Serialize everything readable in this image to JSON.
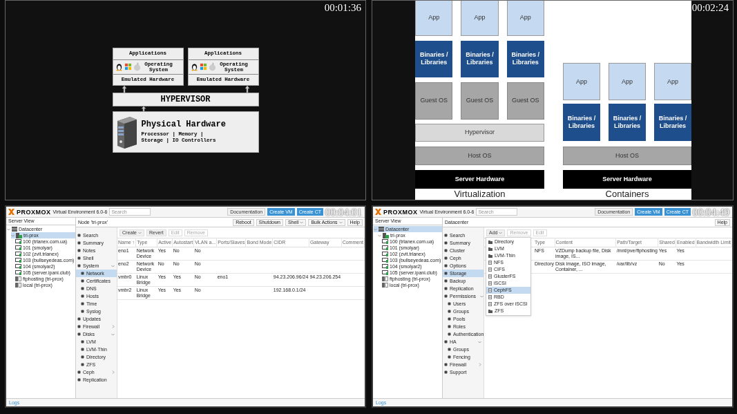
{
  "hypervisor_slide": {
    "timestamp": "00:01:36",
    "vms": [
      {
        "applications": "Applications",
        "os": "Operating System",
        "hardware": "Emulated Hardware"
      },
      {
        "applications": "Applications",
        "os": "Operating System",
        "hardware": "Emulated Hardware"
      }
    ],
    "hypervisor": "HYPERVISOR",
    "physical": {
      "title": "Physical Hardware",
      "specs": [
        "Processor | Memory |",
        "Storage | IO Controllers"
      ]
    }
  },
  "comparison_slide": {
    "timestamp": "00:02:24",
    "virtualization": {
      "apps": [
        "App",
        "App",
        "App"
      ],
      "binaries": [
        "Binaries / Libraries",
        "Binaries / Libraries",
        "Binaries / Libraries"
      ],
      "guests": [
        "Guest OS",
        "Guest OS",
        "Guest OS"
      ],
      "hypervisor": "Hypervisor",
      "host": "Host OS",
      "hardware": "Server Hardware",
      "caption": "Virtualization"
    },
    "containers": {
      "apps": [
        "App",
        "App",
        "App"
      ],
      "binaries": [
        "Binaries / Libraries",
        "Binaries / Libraries",
        "Binaries / Libraries"
      ],
      "host": "Host OS",
      "hardware": "Server Hardware",
      "caption": "Containers"
    }
  },
  "proxmox_panels": [
    {
      "timestamp": "00:04:01",
      "logo": "PROXMOX",
      "version": "Virtual Environment 6.0-6",
      "search_placeholder": "Search",
      "header_buttons": [
        {
          "label": "Documentation",
          "kind": "plain"
        },
        {
          "label": "Create VM",
          "kind": "primary"
        },
        {
          "label": "Create CT",
          "kind": "primary"
        }
      ],
      "view": "Server View",
      "tree": [
        {
          "label": "Datacenter",
          "kind": "datacenter",
          "selected": false,
          "children": [
            {
              "label": "tri-prox",
              "kind": "node",
              "selected": true,
              "children": [
                {
                  "label": "100 (trlanex.com.ua)",
                  "kind": "vm",
                  "selected": false
                },
                {
                  "label": "101 (smolyar)",
                  "kind": "vm",
                  "selected": false
                },
                {
                  "label": "102 (zvit.trlanex)",
                  "kind": "vm",
                  "selected": false
                },
                {
                  "label": "103 (bullseyedeas.com)",
                  "kind": "vm",
                  "selected": false
                },
                {
                  "label": "104 (smolyar2)",
                  "kind": "vm",
                  "selected": false
                },
                {
                  "label": "105 (server.ipani.club)",
                  "kind": "vm",
                  "selected": false
                },
                {
                  "label": "ftphosting (tri-prox)",
                  "kind": "storage",
                  "selected": false
                },
                {
                  "label": "local (tri-prox)",
                  "kind": "storage",
                  "selected": false
                }
              ]
            }
          ]
        }
      ],
      "breadcrumb": "Node 'tri-prox'",
      "actions": [
        {
          "label": "Reboot",
          "dropdown": false
        },
        {
          "label": "Shutdown",
          "dropdown": false
        },
        {
          "label": "Shell",
          "dropdown": true
        },
        {
          "label": "Bulk Actions",
          "dropdown": true
        },
        {
          "label": "Help",
          "dropdown": false
        }
      ],
      "menu": [
        {
          "label": "Search",
          "selected": false
        },
        {
          "label": "Summary",
          "selected": false
        },
        {
          "label": "Notes",
          "selected": false
        },
        {
          "label": "Shell",
          "selected": false
        },
        {
          "label": "System",
          "selected": false,
          "expanded": true,
          "children": [
            {
              "label": "Network",
              "selected": true
            },
            {
              "label": "Certificates",
              "selected": false
            },
            {
              "label": "DNS",
              "selected": false
            },
            {
              "label": "Hosts",
              "selected": false
            },
            {
              "label": "Time",
              "selected": false
            },
            {
              "label": "Syslog",
              "selected": false
            }
          ]
        },
        {
          "label": "Updates",
          "selected": false
        },
        {
          "label": "Firewall",
          "selected": false,
          "expanded": false
        },
        {
          "label": "Disks",
          "selected": false,
          "expanded": true,
          "children": [
            {
              "label": "LVM",
              "selected": false
            },
            {
              "label": "LVM-Thin",
              "selected": false
            },
            {
              "label": "Directory",
              "selected": false
            },
            {
              "label": "ZFS",
              "selected": false
            }
          ]
        },
        {
          "label": "Ceph",
          "selected": false,
          "expanded": false
        },
        {
          "label": "Replication",
          "selected": false
        }
      ],
      "toolbar": [
        {
          "label": "Create",
          "dropdown": true,
          "disabled": false
        },
        {
          "label": "Revert",
          "dropdown": false,
          "disabled": false
        },
        {
          "label": "Edit",
          "dropdown": false,
          "disabled": true
        },
        {
          "label": "Remove",
          "dropdown": false,
          "disabled": true
        }
      ],
      "table": {
        "columns": [
          "Name ↑",
          "Type",
          "Active",
          "Autostart",
          "VLAN a...",
          "Ports/Slaves",
          "Bond Mode",
          "CIDR",
          "Gateway",
          "Comment"
        ],
        "rows": [
          [
            "eno1",
            "Network Device",
            "Yes",
            "No",
            "No",
            "",
            "",
            "",
            "",
            ""
          ],
          [
            "eno2",
            "Network Device",
            "No",
            "No",
            "No",
            "",
            "",
            "",
            "",
            ""
          ],
          [
            "vmbr0",
            "Linux Bridge",
            "Yes",
            "Yes",
            "No",
            "eno1",
            "",
            "94.23.206.96/24",
            "94.23.206.254",
            ""
          ],
          [
            "vmbr2",
            "Linux Bridge",
            "Yes",
            "Yes",
            "No",
            "",
            "",
            "192.168.0.1/24",
            "",
            ""
          ]
        ]
      },
      "logs": "Logs"
    },
    {
      "timestamp": "00:04:49",
      "logo": "PROXMOX",
      "version": "Virtual Environment 6.0-6",
      "search_placeholder": "Search",
      "header_buttons": [
        {
          "label": "Documentation",
          "kind": "plain"
        },
        {
          "label": "Create VM",
          "kind": "primary"
        },
        {
          "label": "Create CT",
          "kind": "primary"
        }
      ],
      "view": "Server View",
      "tree": [
        {
          "label": "Datacenter",
          "kind": "datacenter",
          "selected": true,
          "children": [
            {
              "label": "tri-prox",
              "kind": "node",
              "selected": false,
              "children": [
                {
                  "label": "100 (trlanex.com.ua)",
                  "kind": "vm",
                  "selected": false
                },
                {
                  "label": "101 (smolyar)",
                  "kind": "vm",
                  "selected": false
                },
                {
                  "label": "102 (zvit.trlanex)",
                  "kind": "vm",
                  "selected": false
                },
                {
                  "label": "103 (bullseyedeas.com)",
                  "kind": "vm",
                  "selected": false
                },
                {
                  "label": "104 (smolyar2)",
                  "kind": "vm",
                  "selected": false
                },
                {
                  "label": "105 (server.ipani.club)",
                  "kind": "vm",
                  "selected": false
                },
                {
                  "label": "ftphosting (tri-prox)",
                  "kind": "storage",
                  "selected": false
                },
                {
                  "label": "local (tri-prox)",
                  "kind": "storage",
                  "selected": false
                }
              ]
            }
          ]
        }
      ],
      "breadcrumb": "Datacenter",
      "actions": [
        {
          "label": "Help",
          "dropdown": false
        }
      ],
      "menu": [
        {
          "label": "Search",
          "selected": false
        },
        {
          "label": "Summary",
          "selected": false
        },
        {
          "label": "Cluster",
          "selected": false
        },
        {
          "label": "Ceph",
          "selected": false
        },
        {
          "label": "Options",
          "selected": false
        },
        {
          "label": "Storage",
          "selected": true
        },
        {
          "label": "Backup",
          "selected": false
        },
        {
          "label": "Replication",
          "selected": false
        },
        {
          "label": "Permissions",
          "selected": false,
          "expanded": true,
          "children": [
            {
              "label": "Users",
              "selected": false
            },
            {
              "label": "Groups",
              "selected": false
            },
            {
              "label": "Pools",
              "selected": false
            },
            {
              "label": "Roles",
              "selected": false
            },
            {
              "label": "Authentication",
              "selected": false
            }
          ]
        },
        {
          "label": "HA",
          "selected": false,
          "expanded": true,
          "children": [
            {
              "label": "Groups",
              "selected": false
            },
            {
              "label": "Fencing",
              "selected": false
            }
          ]
        },
        {
          "label": "Firewall",
          "selected": false,
          "expanded": false
        },
        {
          "label": "Support",
          "selected": false
        }
      ],
      "toolbar": [
        {
          "label": "Add",
          "dropdown": true,
          "disabled": false
        },
        {
          "label": "Remove",
          "dropdown": false,
          "disabled": true
        },
        {
          "label": "Edit",
          "dropdown": false,
          "disabled": true
        }
      ],
      "table": {
        "columns": [
          "Type",
          "Content",
          "Path/Target",
          "Shared",
          "Enabled",
          "Bandwidth Limit"
        ],
        "rows": [
          [
            "NFS",
            "VZDump backup file, Disk image, IS...",
            "/mnt/pve/ftphosting",
            "Yes",
            "Yes",
            ""
          ],
          [
            "Directory",
            "Disk image, ISO image, Container, ...",
            "/var/lib/vz",
            "No",
            "Yes",
            ""
          ]
        ]
      },
      "add_menu": [
        {
          "label": "Directory",
          "kind": "folder",
          "selected": false
        },
        {
          "label": "LVM",
          "kind": "folder",
          "selected": false
        },
        {
          "label": "LVM-Thin",
          "kind": "folder",
          "selected": false
        },
        {
          "label": "NFS",
          "kind": "storage",
          "selected": false
        },
        {
          "label": "CIFS",
          "kind": "storage",
          "selected": false
        },
        {
          "label": "GlusterFS",
          "kind": "storage",
          "selected": false
        },
        {
          "label": "iSCSI",
          "kind": "storage",
          "selected": false
        },
        {
          "label": "CephFS",
          "kind": "storage",
          "selected": true
        },
        {
          "label": "RBD",
          "kind": "storage",
          "selected": false
        },
        {
          "label": "ZFS over iSCSI",
          "kind": "storage",
          "selected": false
        },
        {
          "label": "ZFS",
          "kind": "folder",
          "selected": false
        }
      ],
      "logs": "Logs"
    }
  ]
}
